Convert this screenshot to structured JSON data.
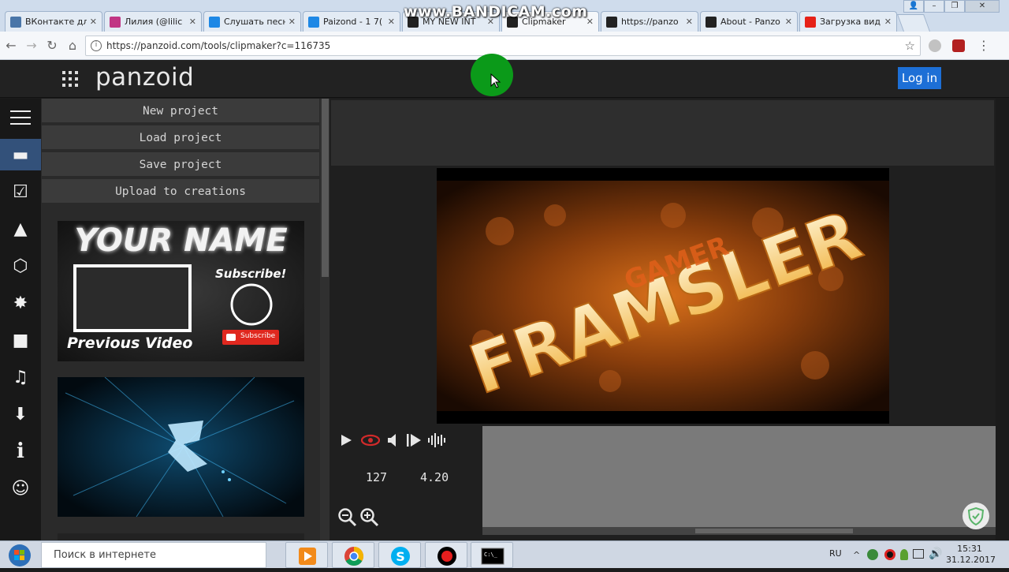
{
  "browser": {
    "tabs": [
      {
        "label": "ВКонтакте дл",
        "fav": "vk-icon",
        "color": "#4a76a8",
        "active": false
      },
      {
        "label": "Лилия (@lilic",
        "fav": "instagram-icon",
        "color": "#c13584",
        "active": false
      },
      {
        "label": "Слушать песн",
        "fav": "search-q-icon",
        "color": "#1e88e5",
        "active": false
      },
      {
        "label": "Paizond - 1 7(",
        "fav": "search-q-icon",
        "color": "#1e88e5",
        "active": false
      },
      {
        "label": "MY NEW INT",
        "fav": "panzoid-icon",
        "color": "#222222",
        "active": false
      },
      {
        "label": "Clipmaker",
        "fav": "panzoid-icon",
        "color": "#222222",
        "active": true
      },
      {
        "label": "https://panzo",
        "fav": "panzoid-icon",
        "color": "#222222",
        "active": false
      },
      {
        "label": "About - Panzo",
        "fav": "panzoid-icon",
        "color": "#222222",
        "active": false
      },
      {
        "label": "Загрузка вид",
        "fav": "youtube-icon",
        "color": "#e62117",
        "active": false
      }
    ],
    "url": "https://panzoid.com/tools/clipmaker?c=116735",
    "watermark": "www.BANDICAM.com"
  },
  "header": {
    "logo": "panzoid",
    "login_label": "Log in"
  },
  "rail": [
    {
      "name": "menu-icon",
      "glyph": ""
    },
    {
      "name": "folder-icon",
      "glyph": "▬"
    },
    {
      "name": "checkbox-icon",
      "glyph": "☑"
    },
    {
      "name": "landscape-icon",
      "glyph": "▲"
    },
    {
      "name": "cube-icon",
      "glyph": "⬡"
    },
    {
      "name": "burst-icon",
      "glyph": "✸"
    },
    {
      "name": "camera-icon",
      "glyph": "■"
    },
    {
      "name": "music-icon",
      "glyph": "♫"
    },
    {
      "name": "download-icon",
      "glyph": "⬇"
    },
    {
      "name": "info-icon",
      "glyph": "i"
    },
    {
      "name": "smiley-icon",
      "glyph": "☺"
    }
  ],
  "panel": {
    "buttons": [
      "New project",
      "Load project",
      "Save project",
      "Upload to creations"
    ],
    "thumb1": {
      "title": "YOUR NAME",
      "subscribe": "Subscribe!",
      "button": "Subscribe",
      "caption": "Previous Video"
    }
  },
  "preview": {
    "text_main": "FRAMSLER",
    "text_sub": "GAMER"
  },
  "controls": {
    "frame": "127",
    "time": "4.20"
  },
  "taskbar": {
    "search_placeholder": "Поиск в интернете",
    "lang": "RU",
    "time": "15:31",
    "date": "31.12.2017"
  },
  "colors": {
    "accent": "#1d6fd6",
    "rail_active": "#33517a",
    "eye": "#d22a2a"
  }
}
